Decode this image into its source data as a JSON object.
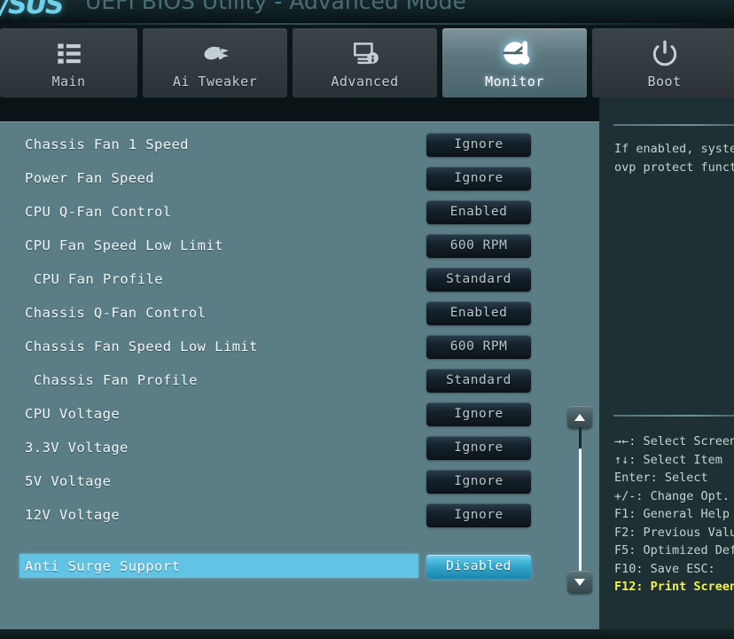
{
  "titlebar": {
    "brand": "/SUS",
    "title_pre": "UEFI BIOS Utility ",
    "title_dot": "-",
    "title_post": " Advanced Mode"
  },
  "tabs": [
    {
      "label": "Main",
      "icon": "list-icon",
      "active": false
    },
    {
      "label": "Ai Tweaker",
      "icon": "bullet-icon",
      "active": false
    },
    {
      "label": "Advanced",
      "icon": "monitor-info-icon",
      "active": false
    },
    {
      "label": "Monitor",
      "icon": "gauge-temp-icon",
      "active": true
    },
    {
      "label": "Boot",
      "icon": "power-icon",
      "active": false
    }
  ],
  "settings": [
    {
      "label": "Chassis Fan 1 Speed",
      "value": "Ignore",
      "indent": false,
      "selected": false
    },
    {
      "label": "Power Fan Speed",
      "value": "Ignore",
      "indent": false,
      "selected": false
    },
    {
      "label": "CPU Q-Fan Control",
      "value": "Enabled",
      "indent": false,
      "selected": false
    },
    {
      "label": "CPU Fan Speed Low Limit",
      "value": "600 RPM",
      "indent": false,
      "selected": false
    },
    {
      "label": "CPU Fan Profile",
      "value": "Standard",
      "indent": true,
      "selected": false
    },
    {
      "label": "Chassis Q-Fan Control",
      "value": "Enabled",
      "indent": false,
      "selected": false
    },
    {
      "label": "Chassis Fan Speed Low Limit",
      "value": "600 RPM",
      "indent": false,
      "selected": false
    },
    {
      "label": "Chassis Fan Profile",
      "value": "Standard",
      "indent": true,
      "selected": false
    },
    {
      "label": "CPU Voltage",
      "value": "Ignore",
      "indent": false,
      "selected": false
    },
    {
      "label": "3.3V Voltage",
      "value": "Ignore",
      "indent": false,
      "selected": false
    },
    {
      "label": "5V Voltage",
      "value": "Ignore",
      "indent": false,
      "selected": false
    },
    {
      "label": "12V Voltage",
      "value": "Ignore",
      "indent": false,
      "selected": false
    },
    {
      "label": "Anti Surge Support",
      "value": "Disabled",
      "indent": false,
      "selected": true
    }
  ],
  "help": {
    "line1": "If enabled, syste",
    "line2": "ovp protect funct"
  },
  "keys": [
    {
      "text": "→←: Select Screen",
      "highlight": false
    },
    {
      "text": "↑↓: Select Item",
      "highlight": false
    },
    {
      "text": "Enter: Select",
      "highlight": false
    },
    {
      "text": "+/-: Change Opt.",
      "highlight": false
    },
    {
      "text": "F1: General Help",
      "highlight": false
    },
    {
      "text": "F2: Previous Valu",
      "highlight": false
    },
    {
      "text": "F5: Optimized Def",
      "highlight": false
    },
    {
      "text": "F10: Save  ESC: ",
      "highlight": false
    },
    {
      "text": "F12: Print Screen",
      "highlight": true
    }
  ],
  "scrollbar": {
    "up": "scroll-up",
    "down": "scroll-down"
  },
  "colors": {
    "panel_bg": "#5b7d85",
    "accent": "#63c3e4",
    "right_bg": "#1e3034",
    "highlight_text": "#f2f24a"
  }
}
